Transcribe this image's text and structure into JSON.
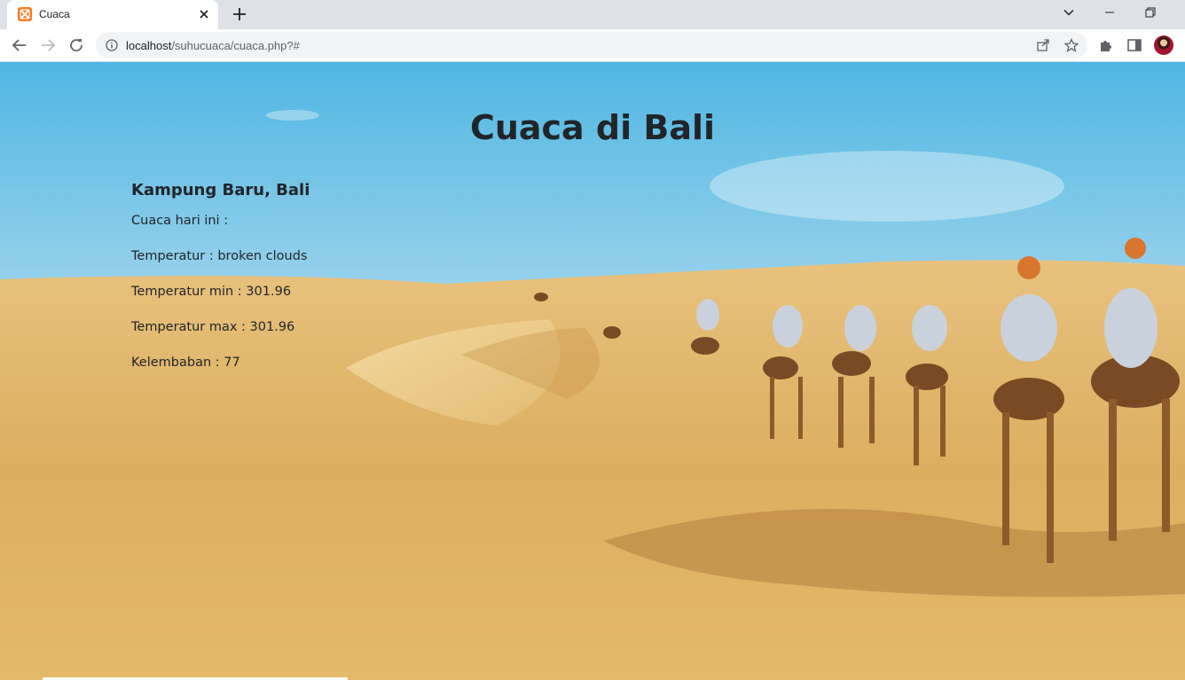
{
  "browser": {
    "tab": {
      "title": "Cuaca",
      "favicon": "xampp-favicon"
    },
    "url": {
      "host": "localhost",
      "path": "/suhucuaca/cuaca.php?#"
    }
  },
  "page": {
    "title": "Cuaca di Bali",
    "location": "Kampung Baru, Bali",
    "today_label": "Cuaca hari ini :",
    "lines": [
      "Temperatur : broken clouds",
      "Temperatur min : 301.96",
      "Temperatur max : 301.96",
      "Kelembaban : 77"
    ]
  },
  "colors": {
    "text": "#212529",
    "favicon": "#fb7a24"
  }
}
